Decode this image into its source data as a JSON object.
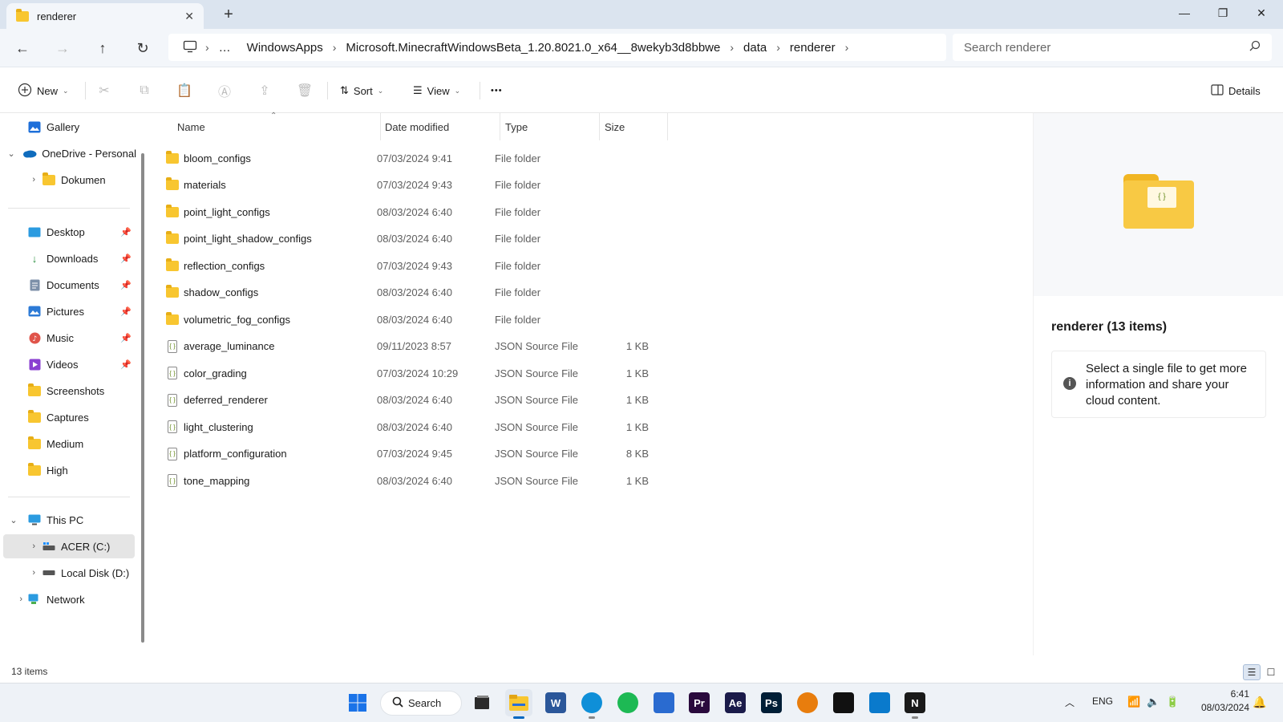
{
  "window": {
    "tab_title": "renderer",
    "close_tab": "✕",
    "new_tab": "+",
    "controls": {
      "minimize": "—",
      "maximize": "❐",
      "close": "✕"
    }
  },
  "nav": {
    "back": "←",
    "forward": "→",
    "up": "↑",
    "refresh": "↻",
    "breadcrumb": [
      "…",
      "WindowsApps",
      "Microsoft.MinecraftWindowsBeta_1.20.8021.0_x64__8wekyb3d8bbwe",
      "data",
      "renderer"
    ],
    "search_placeholder": "Search renderer"
  },
  "commands": {
    "new": "New",
    "sort": "Sort",
    "view": "View",
    "more": "•••",
    "details": "Details"
  },
  "sidebar": {
    "gallery": "Gallery",
    "onedrive": "OneDrive - Personal",
    "dokumen": "Dokumen",
    "quick_access": [
      {
        "label": "Desktop",
        "icon": "desktop-icon",
        "pinned": true
      },
      {
        "label": "Downloads",
        "icon": "download-icon",
        "pinned": true
      },
      {
        "label": "Documents",
        "icon": "documents-icon",
        "pinned": true
      },
      {
        "label": "Pictures",
        "icon": "pictures-icon",
        "pinned": true
      },
      {
        "label": "Music",
        "icon": "music-icon",
        "pinned": true
      },
      {
        "label": "Videos",
        "icon": "videos-icon",
        "pinned": true
      },
      {
        "label": "Screenshots",
        "icon": "folder-icon",
        "pinned": false
      },
      {
        "label": "Captures",
        "icon": "folder-icon",
        "pinned": false
      },
      {
        "label": "Medium",
        "icon": "folder-icon",
        "pinned": false
      },
      {
        "label": "High",
        "icon": "folder-icon",
        "pinned": false
      }
    ],
    "this_pc": "This PC",
    "drive_c": "ACER (C:)",
    "drive_d": "Local Disk (D:)",
    "network": "Network"
  },
  "columns": {
    "name": "Name",
    "date": "Date modified",
    "type": "Type",
    "size": "Size"
  },
  "files": [
    {
      "name": "bloom_configs",
      "date": "07/03/2024 9:41",
      "type": "File folder",
      "size": "",
      "kind": "folder"
    },
    {
      "name": "materials",
      "date": "07/03/2024 9:43",
      "type": "File folder",
      "size": "",
      "kind": "folder"
    },
    {
      "name": "point_light_configs",
      "date": "08/03/2024 6:40",
      "type": "File folder",
      "size": "",
      "kind": "folder"
    },
    {
      "name": "point_light_shadow_configs",
      "date": "08/03/2024 6:40",
      "type": "File folder",
      "size": "",
      "kind": "folder"
    },
    {
      "name": "reflection_configs",
      "date": "07/03/2024 9:43",
      "type": "File folder",
      "size": "",
      "kind": "folder"
    },
    {
      "name": "shadow_configs",
      "date": "08/03/2024 6:40",
      "type": "File folder",
      "size": "",
      "kind": "folder"
    },
    {
      "name": "volumetric_fog_configs",
      "date": "08/03/2024 6:40",
      "type": "File folder",
      "size": "",
      "kind": "folder"
    },
    {
      "name": "average_luminance",
      "date": "09/11/2023 8:57",
      "type": "JSON Source File",
      "size": "1 KB",
      "kind": "json"
    },
    {
      "name": "color_grading",
      "date": "07/03/2024 10:29",
      "type": "JSON Source File",
      "size": "1 KB",
      "kind": "json"
    },
    {
      "name": "deferred_renderer",
      "date": "08/03/2024 6:40",
      "type": "JSON Source File",
      "size": "1 KB",
      "kind": "json"
    },
    {
      "name": "light_clustering",
      "date": "08/03/2024 6:40",
      "type": "JSON Source File",
      "size": "1 KB",
      "kind": "json"
    },
    {
      "name": "platform_configuration",
      "date": "07/03/2024 9:45",
      "type": "JSON Source File",
      "size": "8 KB",
      "kind": "json"
    },
    {
      "name": "tone_mapping",
      "date": "08/03/2024 6:40",
      "type": "JSON Source File",
      "size": "1 KB",
      "kind": "json"
    }
  ],
  "details": {
    "title": "renderer (13 items)",
    "info": "Select a single file to get more information and share your cloud content."
  },
  "status": {
    "count": "13 items"
  },
  "taskbar": {
    "search": "Search",
    "apps": [
      {
        "name": "file-explorer-taskbar"
      },
      {
        "name": "word-taskbar",
        "label": "W",
        "color": "#2b579a"
      },
      {
        "name": "edge-taskbar",
        "color": "#0f8fd8"
      },
      {
        "name": "spotify-taskbar",
        "color": "#1db954"
      },
      {
        "name": "store-taskbar",
        "color": "#2a6bd0"
      },
      {
        "name": "premiere-taskbar",
        "label": "Pr",
        "color": "#2a0a3d"
      },
      {
        "name": "after-effects-taskbar",
        "label": "Ae",
        "color": "#1b1b4a"
      },
      {
        "name": "photoshop-taskbar",
        "label": "Ps",
        "color": "#001e36"
      },
      {
        "name": "blender-taskbar",
        "color": "#e87d0d"
      },
      {
        "name": "capcut-taskbar",
        "color": "#111111"
      },
      {
        "name": "vscode-taskbar",
        "color": "#0a7acc"
      },
      {
        "name": "notion-taskbar",
        "label": "N",
        "color": "#1a1a1a"
      }
    ],
    "lang": "ENG",
    "time": "6:41",
    "date": "08/03/2024"
  }
}
